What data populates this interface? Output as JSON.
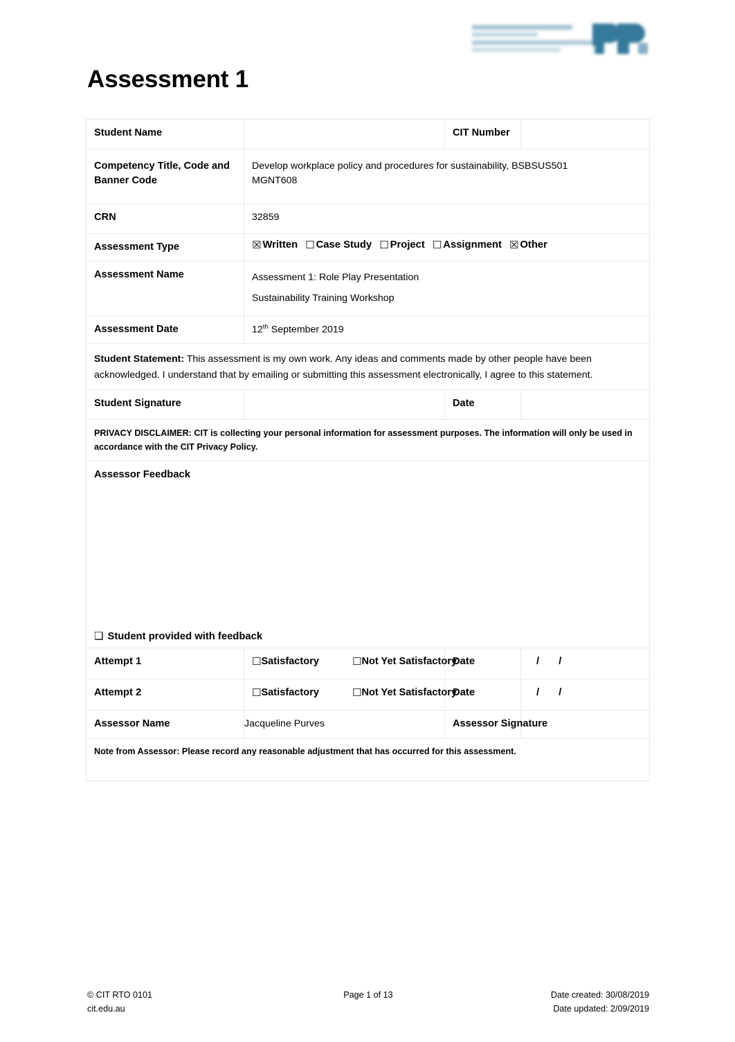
{
  "logo": {
    "name": "cit-logo",
    "alt_text": "Canberra Institute of Technology",
    "colors": {
      "dark_blue": "#2b7296",
      "light_blue": "#a9c8d6",
      "pale": "#cfdfe6"
    }
  },
  "page_title": "Assessment 1",
  "form": {
    "student_name_label": "Student Name",
    "student_name_value": "",
    "cit_number_label": "CIT Number",
    "cit_number_value": "",
    "competency_label": "Competency Title, Code and Banner Code",
    "competency_value_line1": "Develop workplace policy and procedures for sustainability, BSBSUS501",
    "competency_value_line2": "MGNT608",
    "crn_label": "CRN",
    "crn_value": "32859",
    "assessment_type_label": "Assessment Type",
    "assessment_types": [
      {
        "label": "Written",
        "checked": true
      },
      {
        "label": "Case Study",
        "checked": false
      },
      {
        "label": "Project",
        "checked": false
      },
      {
        "label": "Assignment",
        "checked": false
      },
      {
        "label": "Other",
        "checked": true
      }
    ],
    "assessment_name_label": "Assessment Name",
    "assessment_name_line1": "Assessment 1: Role Play Presentation",
    "assessment_name_line2": "Sustainability Training Workshop",
    "assessment_date_label": "Assessment Date",
    "assessment_date_day": "12",
    "assessment_date_suffix": "th",
    "assessment_date_rest": " September 2019",
    "student_statement_label": "Student Statement:",
    "student_statement_text": "  This assessment is my own work.  Any ideas and comments made by other people have been acknowledged.  I understand that by emailing or submitting this assessment electronically, I agree to this statement.",
    "student_signature_label": "Student Signature",
    "student_signature_value": "",
    "date_label": "Date",
    "date_value": "",
    "privacy_disclaimer": "PRIVACY DISCLAIMER:  CIT is collecting your personal information for assessment purposes. The information will only be used in accordance with the CIT Privacy Policy.",
    "assessor_feedback_label": "Assessor Feedback",
    "assessor_feedback_value": "",
    "student_provided_checkbox": "❑",
    "student_provided_label": "Student provided with feedback",
    "attempts": [
      {
        "label": "Attempt 1",
        "satisfactory": "Satisfactory",
        "not_yet_satisfactory": "Not Yet Satisfactory",
        "date_label": "Date",
        "date_slashes": "/  /"
      },
      {
        "label": "Attempt 2",
        "satisfactory": "Satisfactory",
        "not_yet_satisfactory": "Not Yet Satisfactory",
        "date_label": "Date",
        "date_slashes": "/  /"
      }
    ],
    "assessor_name_label": "Assessor Name",
    "assessor_name_value": "Jacqueline Purves",
    "assessor_signature_label": "Assessor Signature",
    "assessor_signature_value": "",
    "note_from_assessor": "Note from Assessor:  Please record any reasonable adjustment that has occurred for this assessment.",
    "note_value": ""
  },
  "icons": {
    "checkbox_unchecked": "☐",
    "checkbox_checked": "☒"
  },
  "footer": {
    "copyright": "© CIT RTO 0101",
    "website": "cit.edu.au",
    "page_number": "Page 1 of 13",
    "date_created": "Date created: 30/08/2019",
    "date_updated": "Date updated: 2/09/2019"
  }
}
